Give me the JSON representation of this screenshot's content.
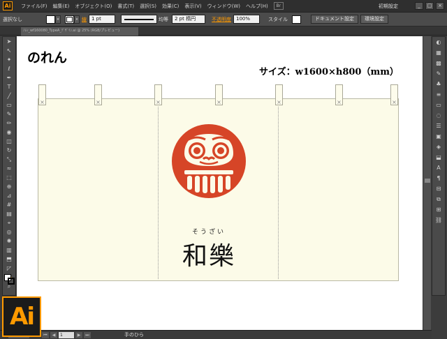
{
  "app": {
    "logo": "Ai",
    "bridge_label": "Br",
    "workspace": "初期設定",
    "window_controls": [
      "_",
      "□",
      "×"
    ]
  },
  "menu": [
    "ファイル(F)",
    "編集(E)",
    "オブジェクト(O)",
    "書式(T)",
    "選択(S)",
    "効果(C)",
    "表示(V)",
    "ウィンドウ(W)",
    "ヘルプ(H)"
  ],
  "controlbar": {
    "selection": "選択なし",
    "stroke_label": "線",
    "stroke_weight": "1 pt",
    "brush_label": "均等",
    "brush_size": "2 pt 楕円",
    "opacity_label": "不透明度",
    "opacity_value": "100%",
    "style_label": "スタイル",
    "doc_settings": "ドキュメント設定",
    "prefs": "環境設定"
  },
  "document_tab": "ﾉﾚﾝ_wf160080_TypeA_ﾃﾞｻﾞｲﾝ.ai @ 25% (RGB/プレビュー)",
  "statusbar": {
    "zoom": "25%",
    "page": "1",
    "tool": "手のひら"
  },
  "artboard": {
    "title": "のれん",
    "size": "サイズ：w1600×h800（mm）",
    "shop_reading": "そうざい",
    "shop_name": "和樂"
  },
  "colors": {
    "accent": "#ff9a00",
    "daruma_red": "#d64527",
    "cloth": "#fcfbe8"
  },
  "tools": [
    "selection-arrow",
    "direct-select",
    "magic-wand",
    "lasso",
    "pen",
    "type",
    "line",
    "rectangle",
    "paintbrush",
    "pencil",
    "blob-brush",
    "eraser",
    "rotate",
    "scale",
    "width",
    "free-transform",
    "shape-builder",
    "perspective",
    "mesh",
    "gradient",
    "eyedropper",
    "blend",
    "symbol-sprayer",
    "column-graph",
    "artboard",
    "slice",
    "hand",
    "zoom"
  ],
  "right_tools": [
    "color",
    "color-guide",
    "swatches",
    "brushes",
    "symbols",
    "stroke",
    "gradient",
    "transparency",
    "appearance",
    "graphic-styles",
    "layers",
    "artboards",
    "character",
    "paragraph",
    "align",
    "pathfinder",
    "transform",
    "links"
  ]
}
